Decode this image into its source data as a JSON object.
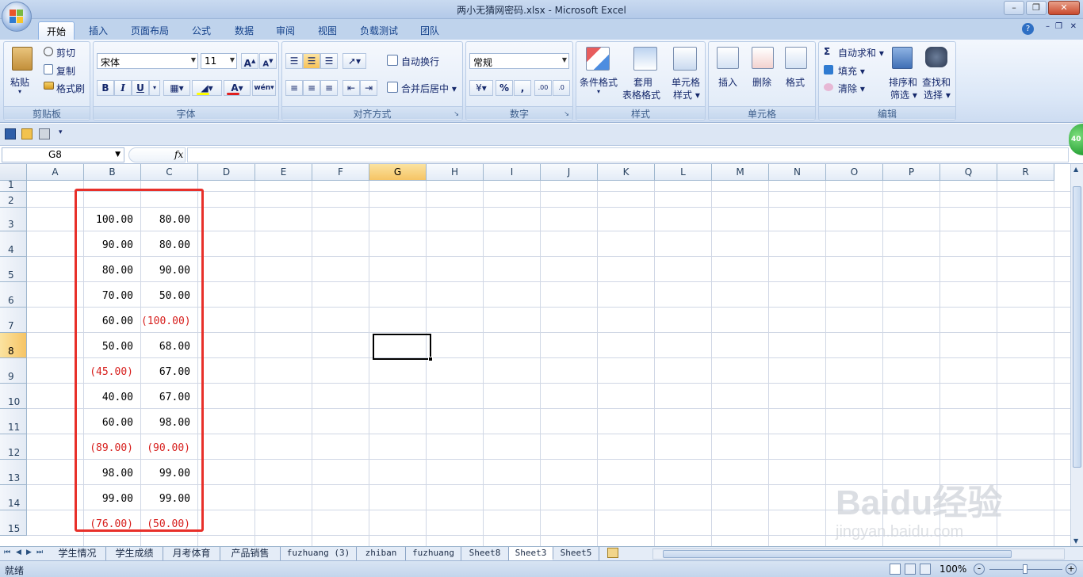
{
  "window": {
    "title": "两小无猜网密码.xlsx - Microsoft Excel"
  },
  "ribbon_tabs": [
    "开始",
    "插入",
    "页面布局",
    "公式",
    "数据",
    "审阅",
    "视图",
    "负载测试",
    "团队"
  ],
  "clipboard": {
    "paste": "粘贴",
    "cut": "剪切",
    "copy": "复制",
    "format_painter": "格式刷",
    "group": "剪贴板"
  },
  "font": {
    "name": "宋体",
    "size": "11",
    "bold": "B",
    "italic": "I",
    "underline": "U",
    "group": "字体"
  },
  "alignment": {
    "wrap": "自动换行",
    "merge": "合并后居中",
    "group": "对齐方式"
  },
  "number": {
    "format": "常规",
    "percent": "%",
    "comma": ",",
    "group": "数字"
  },
  "styles": {
    "conditional": "条件格式",
    "table1": "套用",
    "table2": "表格格式",
    "cell_style1": "单元格",
    "cell_style2": "样式",
    "group": "样式"
  },
  "cells": {
    "insert": "插入",
    "delete": "删除",
    "format": "格式",
    "group": "单元格"
  },
  "editing": {
    "autosum": "自动求和",
    "fill": "填充",
    "clear": "清除",
    "sort1": "排序和",
    "sort2": "筛选",
    "find1": "查找和",
    "find2": "选择",
    "group": "编辑"
  },
  "formula_bar": {
    "name_box": "G8",
    "fx": "fx"
  },
  "columns": [
    "A",
    "B",
    "C",
    "D",
    "E",
    "F",
    "G",
    "H",
    "I",
    "J",
    "K",
    "L",
    "M",
    "N",
    "O",
    "P",
    "Q",
    "R"
  ],
  "rows": [
    "1",
    "2",
    "3",
    "4",
    "5",
    "6",
    "7",
    "8",
    "9",
    "10",
    "11",
    "12",
    "13",
    "14",
    "15"
  ],
  "selected_col": "G",
  "selected_row": "8",
  "cells_data": [
    {
      "row": "3",
      "B": "100.00",
      "C": "80.00",
      "b_neg": false,
      "c_neg": false
    },
    {
      "row": "4",
      "B": "90.00",
      "C": "80.00",
      "b_neg": false,
      "c_neg": false
    },
    {
      "row": "5",
      "B": "80.00",
      "C": "90.00",
      "b_neg": false,
      "c_neg": false
    },
    {
      "row": "6",
      "B": "70.00",
      "C": "50.00",
      "b_neg": false,
      "c_neg": false
    },
    {
      "row": "7",
      "B": "60.00",
      "C": "(100.00)",
      "b_neg": false,
      "c_neg": true
    },
    {
      "row": "8",
      "B": "50.00",
      "C": "68.00",
      "b_neg": false,
      "c_neg": false
    },
    {
      "row": "9",
      "B": "(45.00)",
      "C": "67.00",
      "b_neg": true,
      "c_neg": false
    },
    {
      "row": "10",
      "B": "40.00",
      "C": "67.00",
      "b_neg": false,
      "c_neg": false
    },
    {
      "row": "11",
      "B": "60.00",
      "C": "98.00",
      "b_neg": false,
      "c_neg": false
    },
    {
      "row": "12",
      "B": "(89.00)",
      "C": "(90.00)",
      "b_neg": true,
      "c_neg": true
    },
    {
      "row": "13",
      "B": "98.00",
      "C": "99.00",
      "b_neg": false,
      "c_neg": false
    },
    {
      "row": "14",
      "B": "99.00",
      "C": "99.00",
      "b_neg": false,
      "c_neg": false
    },
    {
      "row": "15",
      "B": "(76.00)",
      "C": "(50.00)",
      "b_neg": true,
      "c_neg": true
    }
  ],
  "sheet_tabs": [
    "学生情况",
    "学生成绩",
    "月考体育",
    "产品销售",
    "fuzhuang (3)",
    "zhiban",
    "fuzhuang",
    "Sheet8",
    "Sheet3",
    "Sheet5"
  ],
  "active_sheet": "Sheet3",
  "status": {
    "ready": "就绪",
    "zoom": "100%"
  },
  "watermark": {
    "brand": "Baidu经验",
    "url": "jingyan.baidu.com"
  },
  "badge": "40",
  "colors": {
    "negative": "#d7201e",
    "highlight_box": "#e8302a",
    "selected_header": "#f6c465"
  }
}
